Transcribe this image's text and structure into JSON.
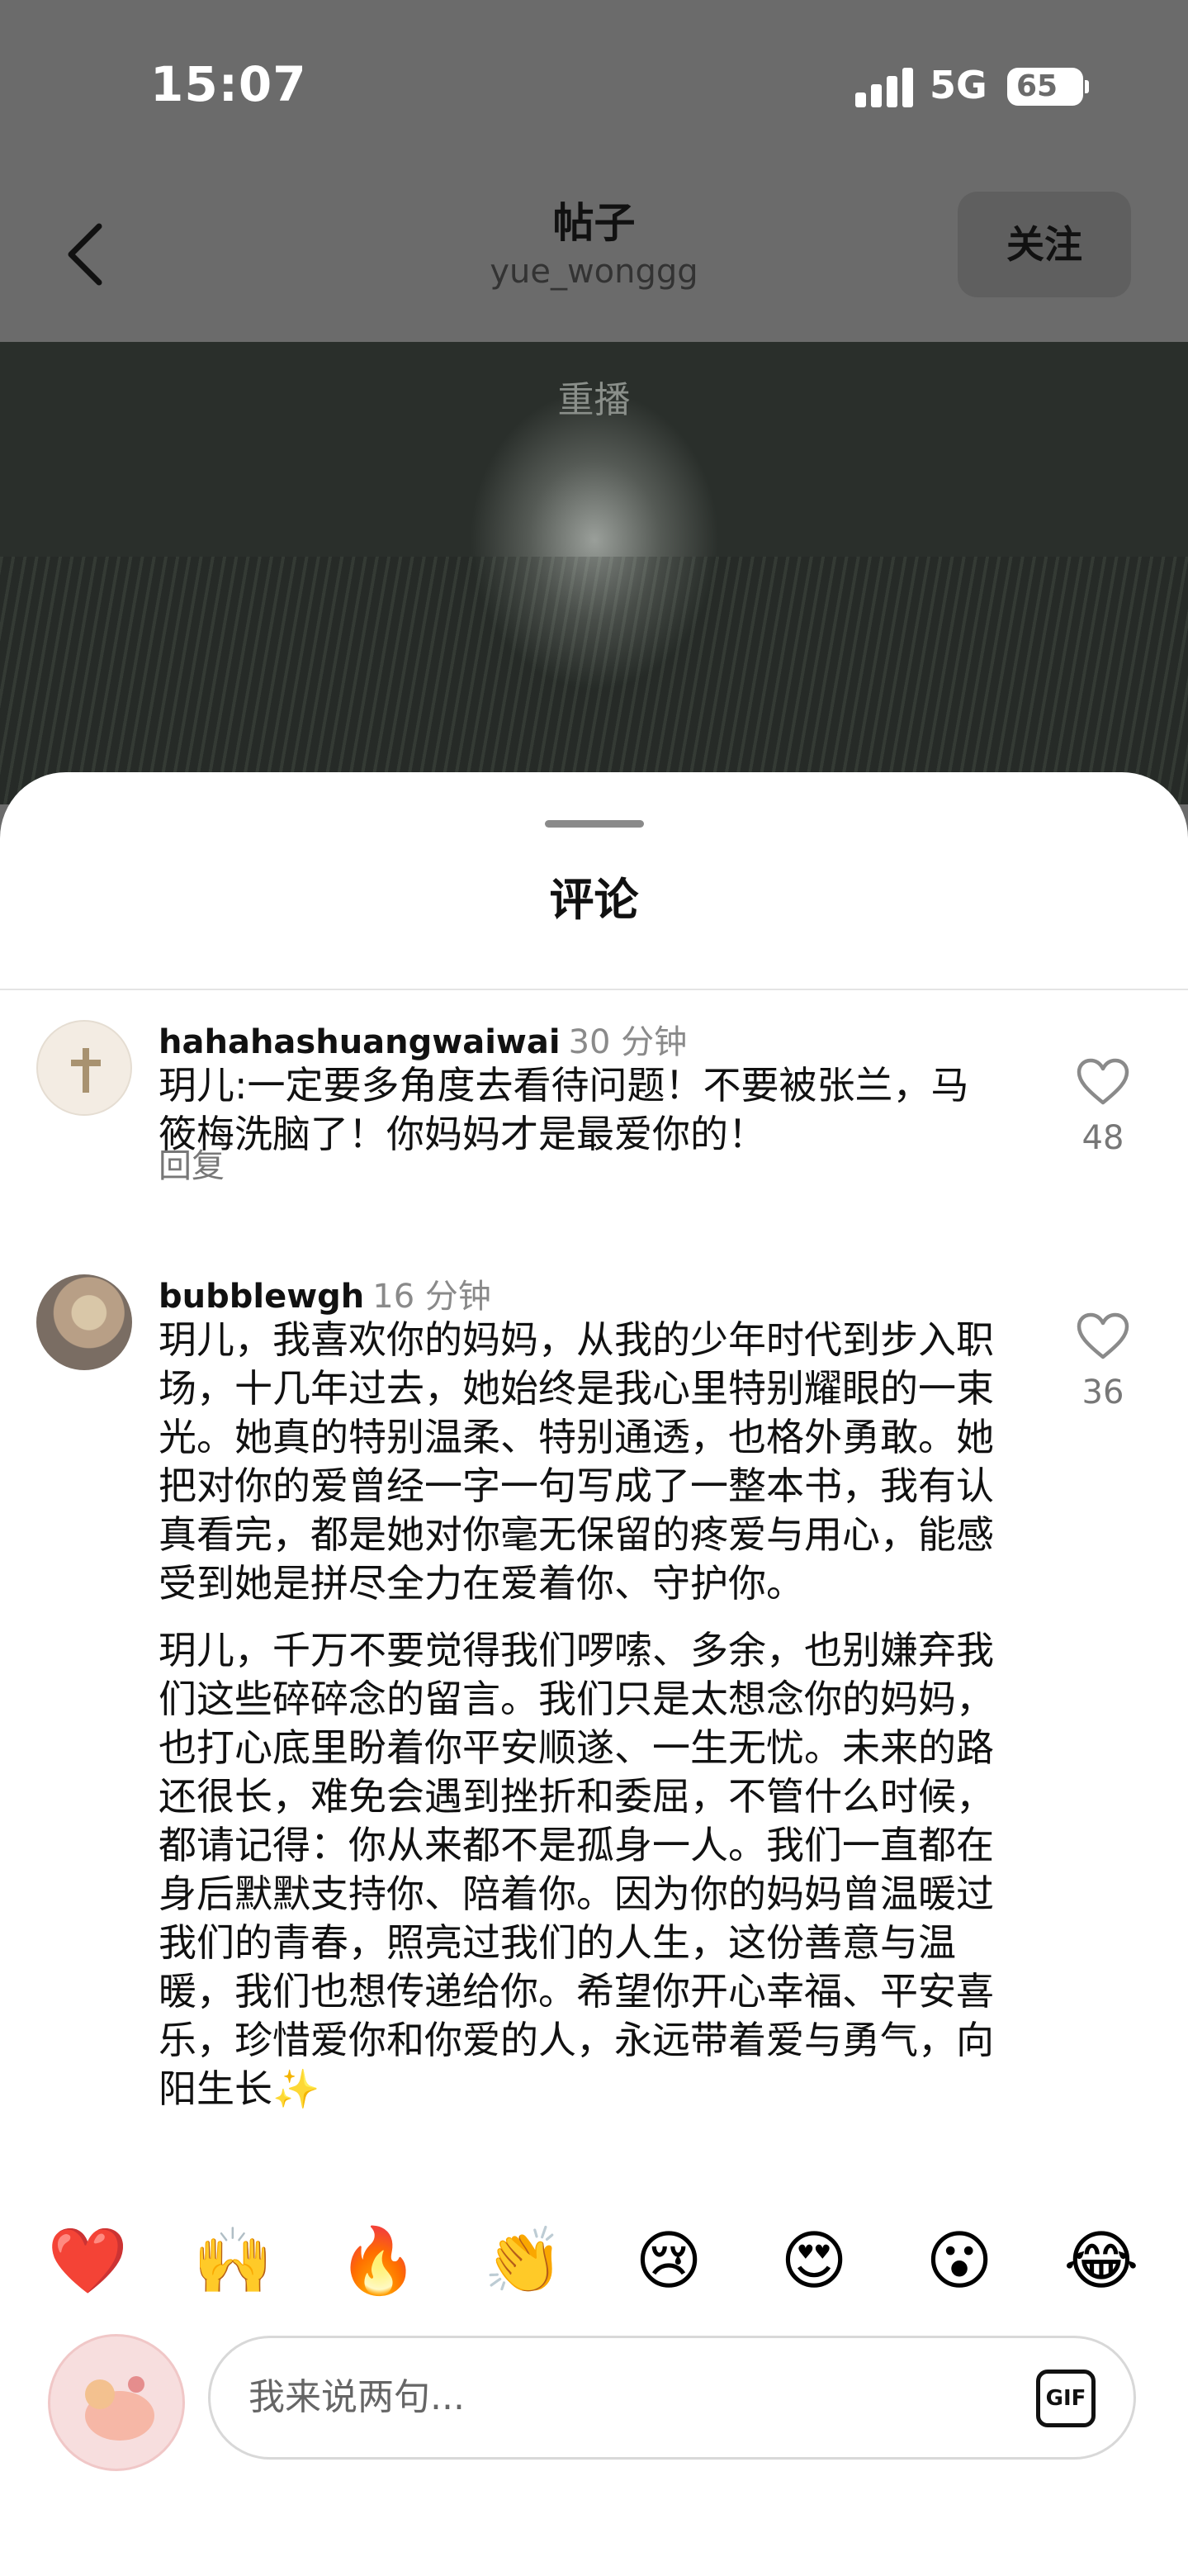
{
  "status_bar": {
    "time": "15:07",
    "network": "5G",
    "battery": "65"
  },
  "header": {
    "title": "帖子",
    "username": "yue_wonggg",
    "follow_label": "关注"
  },
  "video": {
    "replay_label": "重播"
  },
  "comments_sheet": {
    "title": "评论",
    "comments": [
      {
        "username": "hahahashuangwaiwai",
        "time": "30 分钟",
        "text": "玥儿:一定要多角度去看待问题！不要被张兰，马筱梅洗脑了！你妈妈才是最爱你的！",
        "reply_label": "回复",
        "likes": "48"
      },
      {
        "username": "bubblewgh",
        "time": "16 分钟",
        "text_p1": "玥儿，我喜欢你的妈妈，从我的少年时代到步入职场，十几年过去，她始终是我心里特别耀眼的一束光。她真的特别温柔、特别通透，也格外勇敢。她把对你的爱曾经一字一句写成了一整本书，我有认真看完，都是她对你毫无保留的疼爱与用心，能感受到她是拼尽全力在爱着你、守护你。",
        "text_p2": "玥儿，千万不要觉得我们啰嗦、多余，也别嫌弃我们这些碎碎念的留言。我们只是太想念你的妈妈，也打心底里盼着你平安顺遂、一生无忧。未来的路还很长，难免会遇到挫折和委屈，不管什么时候，都请记得：你从来都不是孤身一人。我们一直都在身后默默支持你、陪着你。因为你的妈妈曾温暖过我们的青春，照亮过我们的人生，这份善意与温暖，我们也想传递给你。希望你开心幸福、平安喜乐，珍惜爱你和你爱的人，永远带着爱与勇气，向阳生长✨",
        "likes": "36"
      }
    ]
  },
  "emoji_bar": [
    "❤️",
    "🙌",
    "🔥",
    "👏",
    "😢",
    "😍",
    "😮",
    "😂"
  ],
  "input": {
    "placeholder": "我来说两句...",
    "gif_label": "GIF"
  }
}
